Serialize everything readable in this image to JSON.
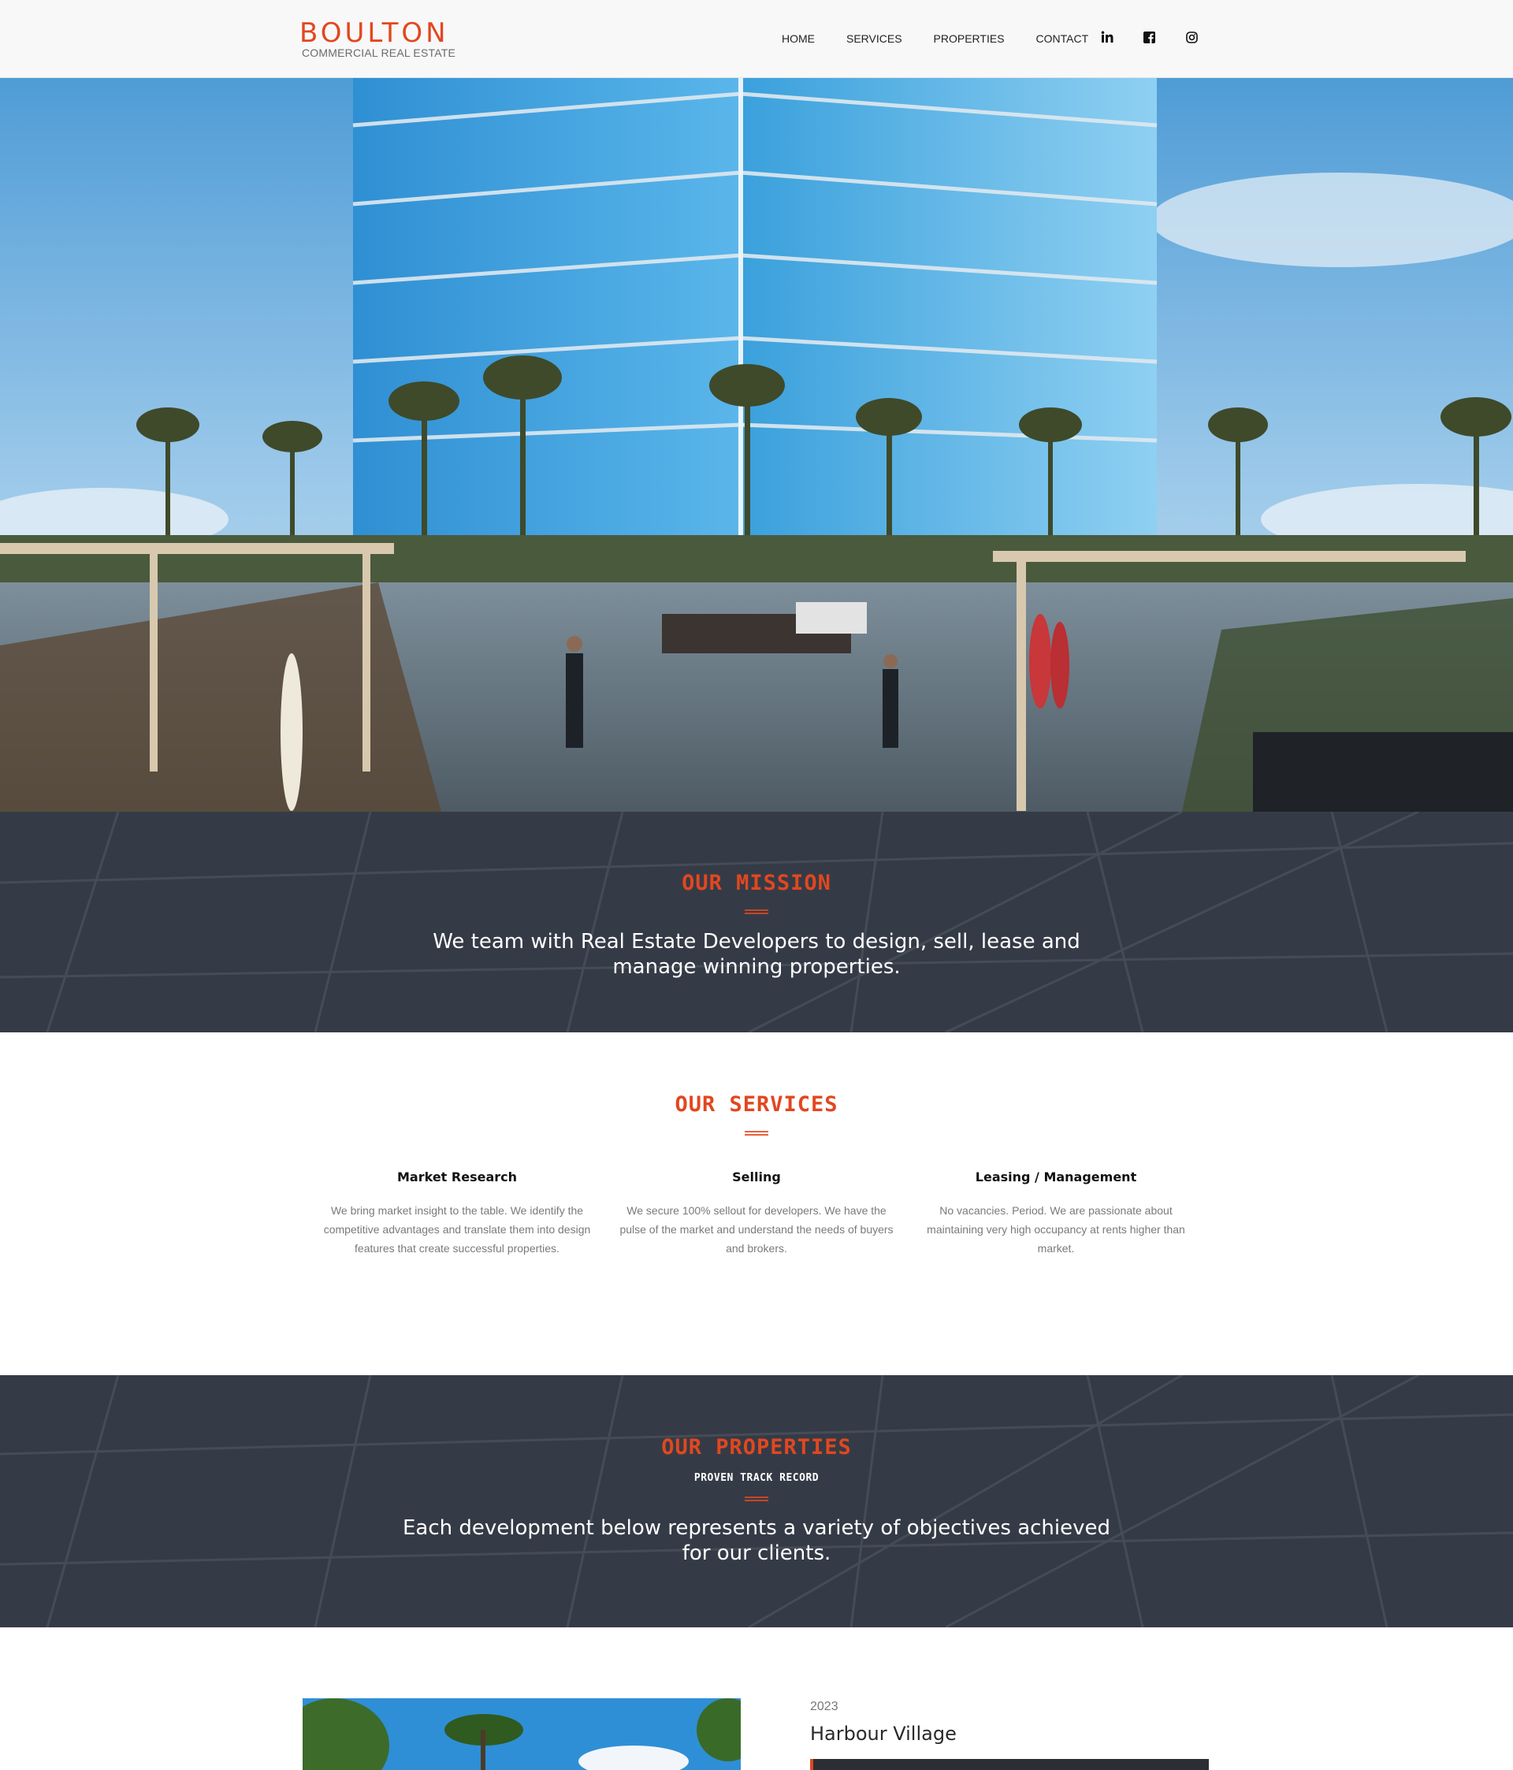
{
  "brand": {
    "name": "BOULTON",
    "tagline": "COMMERCIAL REAL ESTATE",
    "accent": "#e2471f"
  },
  "nav": {
    "items": [
      {
        "label": "HOME"
      },
      {
        "label": "SERVICES"
      },
      {
        "label": "PROPERTIES"
      },
      {
        "label": "CONTACT"
      }
    ],
    "social": [
      {
        "icon": "linkedin-icon"
      },
      {
        "icon": "facebook-icon"
      },
      {
        "icon": "instagram-icon"
      }
    ]
  },
  "hero": {
    "image": "glass-office-tower-courtyard-photo"
  },
  "mission": {
    "title": "OUR MISSION",
    "text": "We team with Real Estate Developers to design, sell, lease and manage winning properties."
  },
  "services": {
    "title": "OUR SERVICES",
    "items": [
      {
        "title": "Market Research",
        "description": "We bring market insight to the table. We identify the competitive advantages and translate them into design features that create successful properties."
      },
      {
        "title": "Selling",
        "description": "We secure 100% sellout for developers. We have the pulse of the market and understand the needs of buyers and brokers."
      },
      {
        "title": "Leasing / Management",
        "description": "No vacancies. Period. We are passionate about maintaining very high occupancy at rents higher than market."
      }
    ]
  },
  "properties": {
    "title": "OUR PROPERTIES",
    "subtitle": "PROVEN TRACK RECORD",
    "text": "Each development below represents a variety of objectives achieved for our clients."
  },
  "property": {
    "year": "2023",
    "name": "Harbour Village"
  }
}
